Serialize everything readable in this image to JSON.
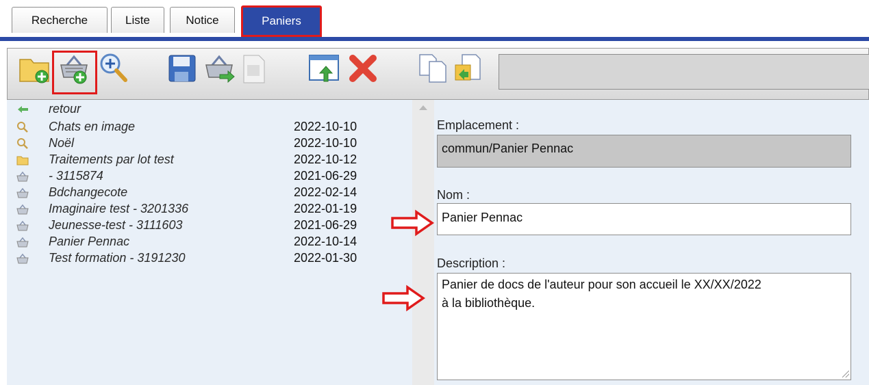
{
  "tabs": [
    {
      "label": "Recherche"
    },
    {
      "label": "Liste"
    },
    {
      "label": "Notice"
    },
    {
      "label": "Paniers",
      "active": true
    }
  ],
  "toolbar": {
    "buttons": [
      {
        "icon": "new-folder-icon"
      },
      {
        "icon": "new-basket-icon",
        "highlighted": true
      },
      {
        "icon": "new-search-icon"
      },
      {
        "icon": "save-icon"
      },
      {
        "icon": "move-basket-icon"
      },
      {
        "icon": "document-icon"
      },
      {
        "icon": "export-window-icon"
      },
      {
        "icon": "delete-icon"
      },
      {
        "icon": "copy-icon"
      },
      {
        "icon": "paste-icon"
      }
    ],
    "field_value": ""
  },
  "list": {
    "items": [
      {
        "icon": "back-arrow-icon",
        "label": "retour",
        "date": ""
      },
      {
        "icon": "search-icon",
        "label": "Chats en image",
        "date": "2022-10-10"
      },
      {
        "icon": "search-icon",
        "label": "Noël",
        "date": "2022-10-10"
      },
      {
        "icon": "folder-icon",
        "label": "Traitements par lot test",
        "date": "2022-10-12"
      },
      {
        "icon": "basket-icon",
        "label": "- 3115874",
        "date": "2021-06-29"
      },
      {
        "icon": "basket-icon",
        "label": "Bdchangecote",
        "date": "2022-02-14"
      },
      {
        "icon": "basket-icon",
        "label": "Imaginaire test - 3201336",
        "date": "2022-01-19"
      },
      {
        "icon": "basket-icon",
        "label": "Jeunesse-test - 3111603",
        "date": "2021-06-29"
      },
      {
        "icon": "basket-icon",
        "label": "Panier Pennac",
        "date": "2022-10-14"
      },
      {
        "icon": "basket-icon",
        "label": "Test formation - 3191230",
        "date": "2022-01-30"
      }
    ]
  },
  "form": {
    "emplacement_label": "Emplacement :",
    "emplacement_value": "commun/Panier Pennac",
    "nom_label": "Nom :",
    "nom_value": "Panier Pennac",
    "description_label": "Description :",
    "description_value": "Panier de docs de l'auteur pour son accueil le XX/XX/2022\nà la bibliothèque."
  },
  "colors": {
    "accent": "#2c4aa6",
    "highlight": "#e01b1b",
    "panel_bg": "#e9f0f8"
  }
}
